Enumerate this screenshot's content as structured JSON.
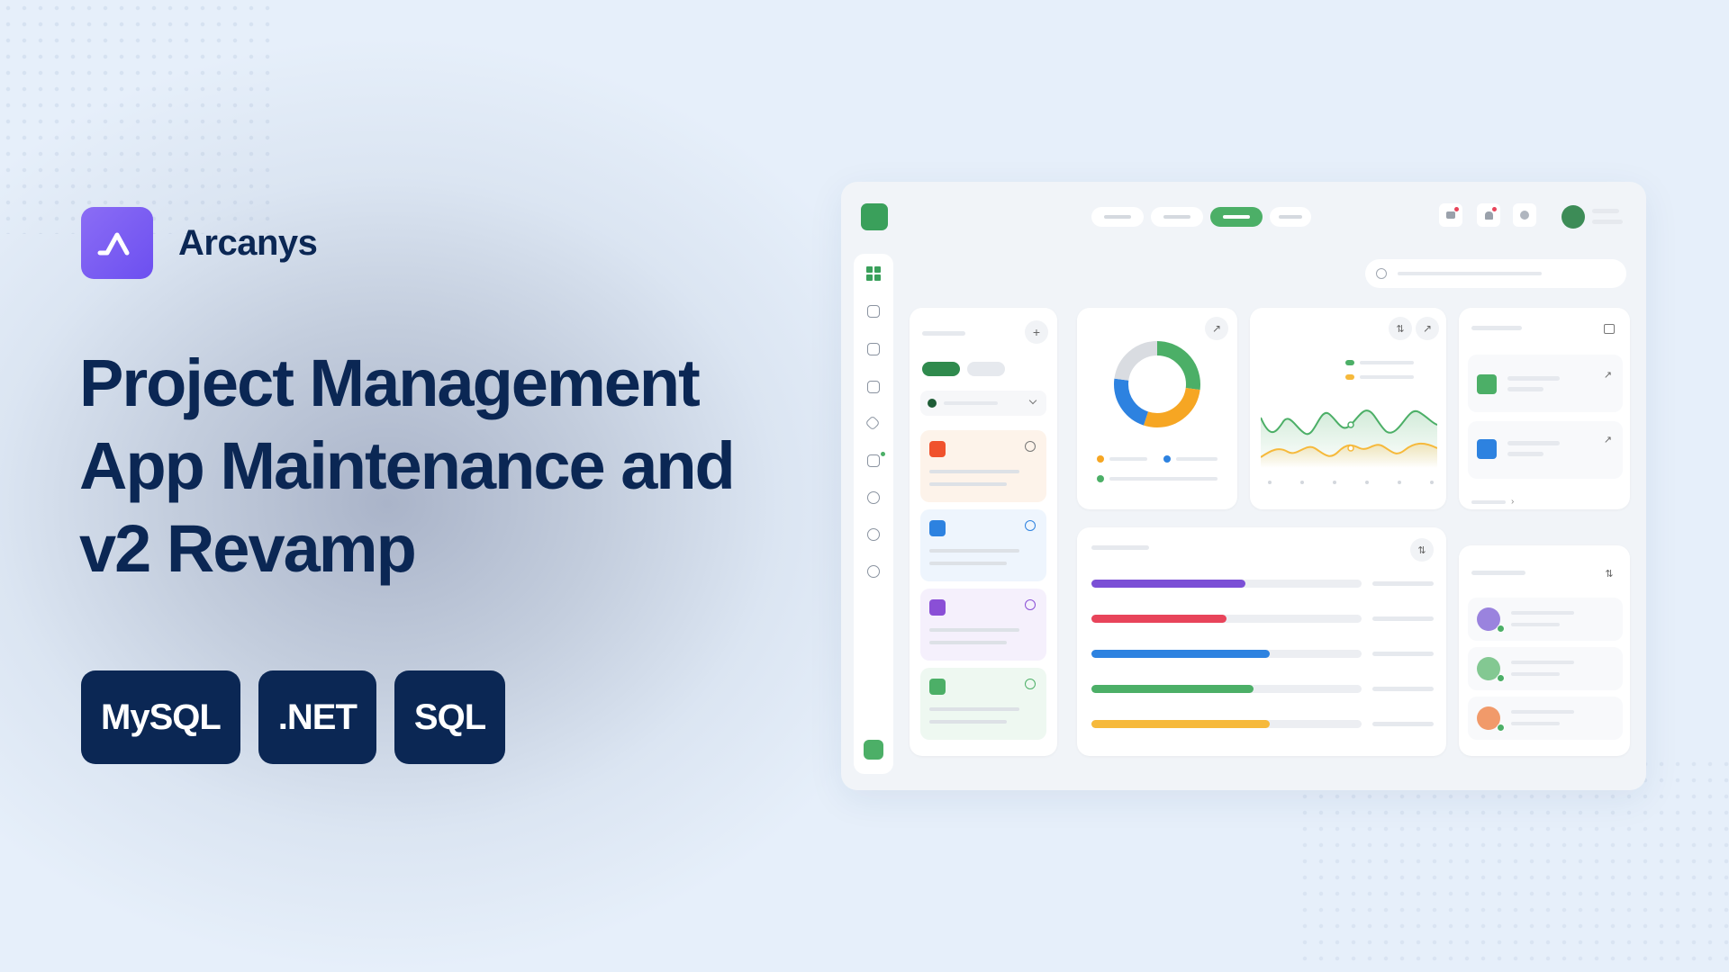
{
  "brand": {
    "name": "Arcanys",
    "logo_icon": "arcanys-logo-icon",
    "logo_color": "#7057f2"
  },
  "headline": {
    "line1": "Project Management",
    "line2": "App Maintenance and",
    "line3": "v2 Revamp"
  },
  "tags": [
    "MySQL",
    ".NET",
    "SQL"
  ],
  "colors": {
    "navy": "#0b2754",
    "green": "#4caf67",
    "orange": "#f0522d",
    "blue": "#2d82e0",
    "purple": "#8a4fd6",
    "yellow": "#f6b93b",
    "red": "#e8445a"
  },
  "dashboard": {
    "donut_segments": [
      {
        "color": "#4caf67",
        "fraction": 0.27
      },
      {
        "color": "#f6a623",
        "fraction": 0.28
      },
      {
        "color": "#2d82e0",
        "fraction": 0.22
      },
      {
        "color": "#d9dce1",
        "fraction": 0.23
      }
    ],
    "progress_bars": [
      {
        "color": "#7b4fd6",
        "fraction": 0.57
      },
      {
        "color": "#e8445a",
        "fraction": 0.5
      },
      {
        "color": "#2d82e0",
        "fraction": 0.66
      },
      {
        "color": "#4caf67",
        "fraction": 0.6
      },
      {
        "color": "#f6b93b",
        "fraction": 0.66
      }
    ],
    "task_colors": [
      "#f0522d",
      "#2d82e0",
      "#8a4fd6",
      "#4caf67"
    ],
    "people_colors": [
      "#8a6fd8",
      "#6fbf7f",
      "#f08a50"
    ]
  }
}
